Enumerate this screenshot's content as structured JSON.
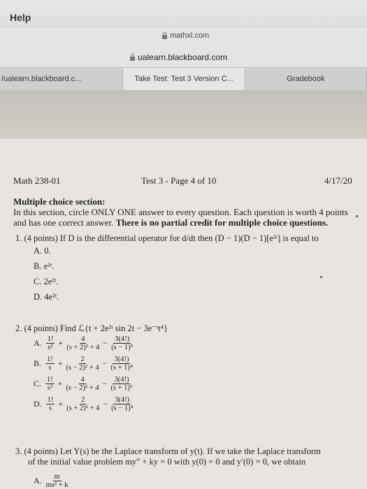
{
  "menu": {
    "help": "Help"
  },
  "urls": {
    "top": "mathxl.com",
    "main": "ualearn.blackboard.com"
  },
  "tabs": [
    "/ualearn.blackboard.c...",
    "Take Test: Test 3 Version C...",
    "Gradebook"
  ],
  "paper": {
    "course": "Math 238-01",
    "test": "Test 3",
    "page": "- Page 4 of 10",
    "date": "4/17/20",
    "section_title": "Multiple choice section:",
    "instr1": "In this section, circle ONLY ONE answer to every question. Each question is worth 4 points",
    "instr2a": "and has one correct answer.",
    "instr2b": "There is no partial credit for multiple choice questions.",
    "q1": "1. (4 points) If D is the differential operator for d/dt then (D − 1)(D − 1)[e²ᵗ] is equal to",
    "q1_options": [
      "A. 0.",
      "B. e²ᵗ.",
      "C. 2e²ᵗ.",
      "D. 4e²ᵗ."
    ],
    "q2": "2. (4 points) Find ℒ{t + 2e²ᵗ sin 2t − 3e⁻ᵗt⁴}",
    "q2_options": [
      {
        "label": "A.",
        "f1n": "1!",
        "f1d": "s²",
        "s1": "+",
        "f2n": "4",
        "f2d": "(s + 2)² + 4",
        "s2": "−",
        "f3n": "3(4!)",
        "f3d": "(s − 1)⁵"
      },
      {
        "label": "B.",
        "f1n": "1!",
        "f1d": "s",
        "s1": "+",
        "f2n": "2",
        "f2d": "(s − 2)² + 4",
        "s2": "−",
        "f3n": "3(4!)",
        "f3d": "(s + 1)⁴"
      },
      {
        "label": "C.",
        "f1n": "1!",
        "f1d": "s²",
        "s1": "+",
        "f2n": "4",
        "f2d": "(s − 2)² + 4",
        "s2": "−",
        "f3n": "3(4!)",
        "f3d": "(s + 1)⁵"
      },
      {
        "label": "D.",
        "f1n": "1!",
        "f1d": "s",
        "s1": "+",
        "f2n": "2",
        "f2d": "(s + 2)² + 4",
        "s2": "−",
        "f3n": "3(4!)",
        "f3d": "(s − 1)⁴"
      }
    ],
    "q3a": "3. (4 points) Let Y(s) be the Laplace transform of y(t). If we take the Laplace transform",
    "q3b": "of the initial value problem my″ + ky = 0 with y(0) = 0 and y′(0) = 0, we obtain",
    "q3_optA_label": "A.",
    "q3_optA_num": "m",
    "q3_optA_den": "ms² + k"
  }
}
